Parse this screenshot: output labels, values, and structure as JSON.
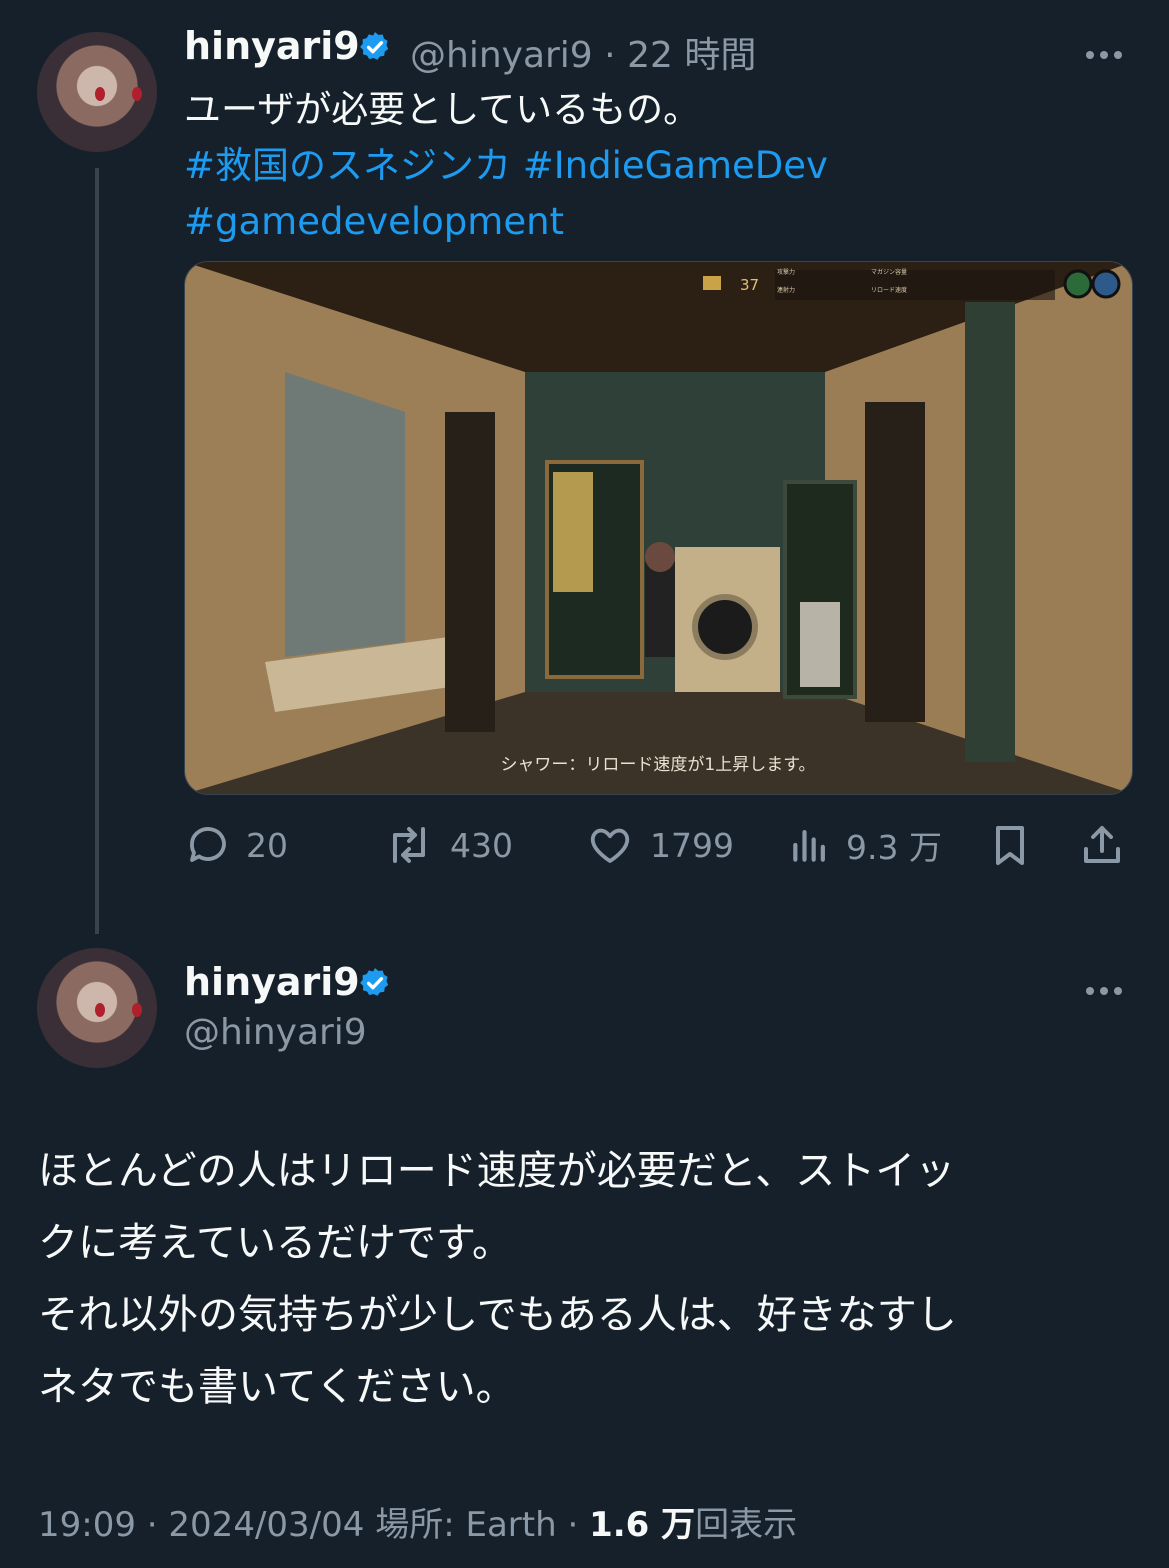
{
  "first_tweet": {
    "display_name": "hinyari9",
    "handle": "@hinyari9",
    "separator": "·",
    "time": "22 時間",
    "text_line": "ユーザが必要としているもの。",
    "hashtags_line1": "#救国のスネジンカ #IndieGameDev",
    "hashtags_line2": "#gamedevelopment",
    "media": {
      "caption": "シャワー：リロード速度が1上昇します。",
      "hud_count": "37",
      "hud_stats": [
        "攻撃力",
        "連射力",
        "マガジン容量",
        "リロード速度"
      ]
    },
    "actions": {
      "replies": "20",
      "reposts": "430",
      "likes": "1799",
      "views": "9.3 万"
    }
  },
  "main_tweet": {
    "display_name": "hinyari9",
    "handle": "@hinyari9",
    "lines": [
      "ほとんどの人はリロード速度が必要だと、ストイッ",
      "クに考えているだけです。",
      "それ以外の気持ちが少しでもある人は、好きなすし",
      "ネタでも書いてください。"
    ],
    "meta": {
      "time": "19:09",
      "sep1": "·",
      "date": "2024/03/04",
      "location": "場所: Earth",
      "sep2": "·",
      "views_count": "1.6 万",
      "views_label": "回表示"
    }
  },
  "colors": {
    "background": "#15202b",
    "text": "#f7f9f9",
    "muted": "#8b98a5",
    "accent": "#1d9bf0"
  },
  "icons": [
    "verified-badge-icon",
    "more-icon",
    "reply-icon",
    "repost-icon",
    "like-icon",
    "views-icon",
    "bookmark-icon",
    "share-icon"
  ]
}
